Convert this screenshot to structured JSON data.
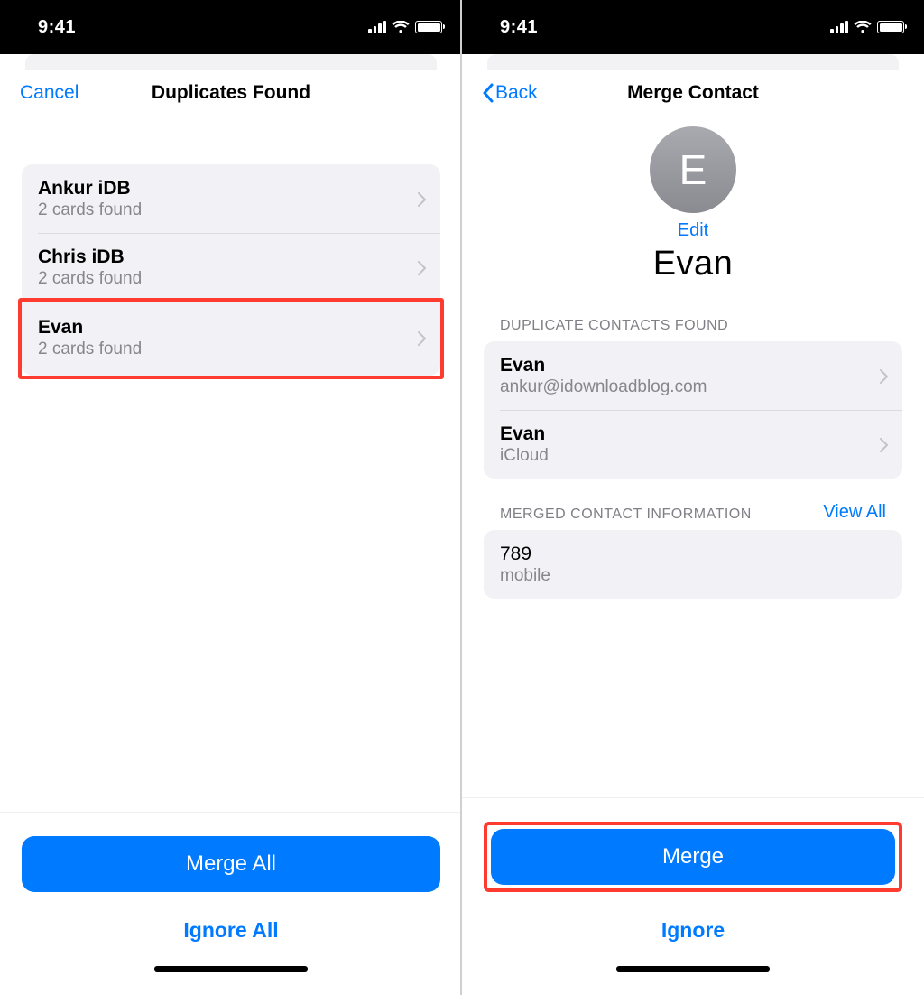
{
  "status": {
    "time": "9:41"
  },
  "left": {
    "nav": {
      "cancel": "Cancel",
      "title": "Duplicates Found"
    },
    "rows": [
      {
        "title": "Ankur iDB",
        "sub": "2 cards found"
      },
      {
        "title": "Chris iDB",
        "sub": "2 cards found"
      },
      {
        "title": "Evan",
        "sub": "2 cards found"
      }
    ],
    "footer": {
      "primary": "Merge All",
      "secondary": "Ignore All"
    }
  },
  "right": {
    "nav": {
      "back": "Back",
      "title": "Merge Contact"
    },
    "contact": {
      "initial": "E",
      "edit": "Edit",
      "name": "Evan"
    },
    "dupHeader": "DUPLICATE CONTACTS FOUND",
    "dups": [
      {
        "title": "Evan",
        "sub": "ankur@idownloadblog.com"
      },
      {
        "title": "Evan",
        "sub": "iCloud"
      }
    ],
    "mergedHeader": "MERGED CONTACT INFORMATION",
    "viewAll": "View All",
    "merged": [
      {
        "title": "789",
        "sub": "mobile"
      }
    ],
    "footer": {
      "primary": "Merge",
      "secondary": "Ignore"
    }
  }
}
